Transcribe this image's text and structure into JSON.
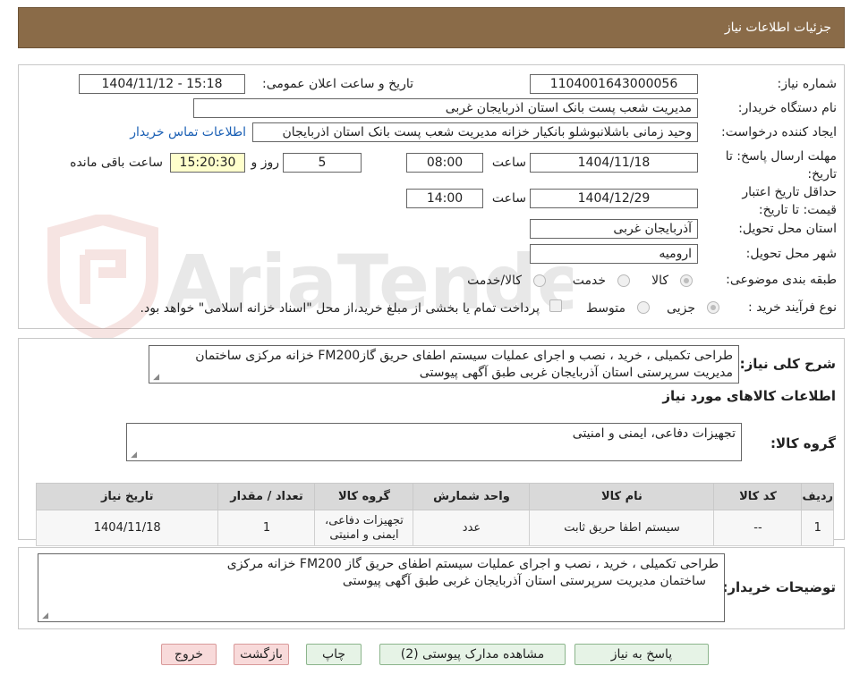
{
  "header": {
    "title": "جزئیات اطلاعات نیاز"
  },
  "watermark": {
    "text": "AriaTender.neT"
  },
  "form": {
    "need_number": {
      "label": "شماره نیاز:",
      "value": "1104001643000056"
    },
    "announce_datetime": {
      "label": "تاریخ و ساعت اعلان عمومی:",
      "value": "1404/11/12 - 15:18"
    },
    "buyer_org": {
      "label": "نام دستگاه خریدار:",
      "value": "مدیریت شعب پست بانک استان اذربایجان غربی"
    },
    "creator": {
      "label": "ایجاد کننده درخواست:",
      "value": "وحید زمانی باشلانبوشلو بانکیار خزانه مدیریت شعب پست بانک استان اذربایجان",
      "contact_link": "اطلاعات تماس خریدار"
    },
    "reply_deadline": {
      "label": "مهلت ارسال پاسخ: تا تاریخ:",
      "date": "1404/11/18",
      "time_label": "ساعت",
      "time": "08:00",
      "days": "5",
      "days_label": "روز و",
      "remaining": "15:20:30",
      "remaining_label": "ساعت باقی مانده"
    },
    "price_validity": {
      "label": "حداقل تاریخ اعتبار قیمت: تا تاریخ:",
      "date": "1404/12/29",
      "time_label": "ساعت",
      "time": "14:00"
    },
    "province": {
      "label": "استان محل تحویل:",
      "value": "آذربایجان غربی"
    },
    "city": {
      "label": "شهر محل تحویل:",
      "value": "ارومیه"
    },
    "category": {
      "label": "طبقه بندی موضوعی:",
      "options": [
        "کالا",
        "خدمت",
        "کالا/خدمت"
      ],
      "selected": "کالا"
    },
    "purchase_process": {
      "label": "نوع فرآیند خرید :",
      "options": [
        "جزیی",
        "متوسط"
      ],
      "selected": "جزیی",
      "treasury_note": "پرداخت تمام یا بخشی از مبلغ خرید،از محل \"اسناد خزانه اسلامی\" خواهد بود."
    }
  },
  "summary": {
    "label": "شرح کلی نیاز:",
    "line1": "طراحی تکمیلی ، خرید ، نصب و اجرای عملیات سیستم اطفای حریق گازFM200 خزانه  مرکزی ساختمان",
    "line2": "مدیریت سرپرستی استان آذربایجان غربی طبق آگهی پیوستی"
  },
  "goods_info": {
    "title": "اطلاعات کالاهای مورد نیاز",
    "group_label": "گروه کالا:",
    "group_value": "تجهیزات دفاعی، ایمنی و امنیتی"
  },
  "table": {
    "headers": [
      "ردیف",
      "کد کالا",
      "نام کالا",
      "واحد شمارش",
      "گروه کالا",
      "تعداد / مقدار",
      "تاریخ نیاز"
    ],
    "rows": [
      {
        "row": "1",
        "code": "--",
        "name": "سیستم اطفا حریق ثابت",
        "unit": "عدد",
        "group_line1": "تجهیزات دفاعی،",
        "group_line2": "ایمنی و امنیتی",
        "qty": "1",
        "date": "1404/11/18"
      }
    ]
  },
  "buyer_notes": {
    "label": "توضیحات خریدار:",
    "line1": "طراحی تکمیلی ، خرید ، نصب و اجرای عملیات سیستم اطفای حریق گاز FM200 خزانه  مرکزی",
    "line2": "ساختمان مدیریت سرپرستی استان آذربایجان غربی طبق آگهی پیوستی"
  },
  "buttons": {
    "reply": "پاسخ به نیاز",
    "attachments": "مشاهده مدارک پیوستی (2)",
    "print": "چاپ",
    "back": "بازگشت",
    "exit": "خروج"
  }
}
